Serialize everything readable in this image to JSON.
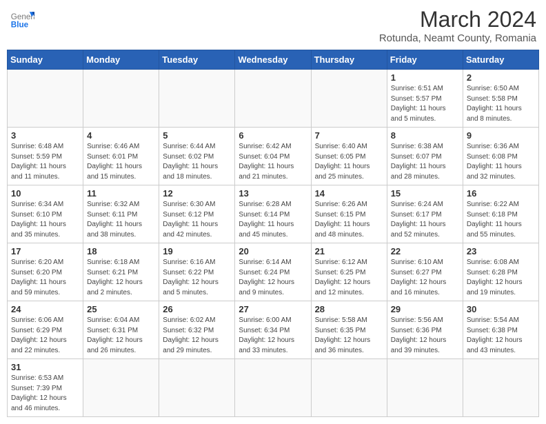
{
  "header": {
    "logo_general": "General",
    "logo_blue": "Blue",
    "month_title": "March 2024",
    "subtitle": "Rotunda, Neamt County, Romania"
  },
  "weekdays": [
    "Sunday",
    "Monday",
    "Tuesday",
    "Wednesday",
    "Thursday",
    "Friday",
    "Saturday"
  ],
  "weeks": [
    [
      {
        "day": "",
        "info": ""
      },
      {
        "day": "",
        "info": ""
      },
      {
        "day": "",
        "info": ""
      },
      {
        "day": "",
        "info": ""
      },
      {
        "day": "",
        "info": ""
      },
      {
        "day": "1",
        "info": "Sunrise: 6:51 AM\nSunset: 5:57 PM\nDaylight: 11 hours\nand 5 minutes."
      },
      {
        "day": "2",
        "info": "Sunrise: 6:50 AM\nSunset: 5:58 PM\nDaylight: 11 hours\nand 8 minutes."
      }
    ],
    [
      {
        "day": "3",
        "info": "Sunrise: 6:48 AM\nSunset: 5:59 PM\nDaylight: 11 hours\nand 11 minutes."
      },
      {
        "day": "4",
        "info": "Sunrise: 6:46 AM\nSunset: 6:01 PM\nDaylight: 11 hours\nand 15 minutes."
      },
      {
        "day": "5",
        "info": "Sunrise: 6:44 AM\nSunset: 6:02 PM\nDaylight: 11 hours\nand 18 minutes."
      },
      {
        "day": "6",
        "info": "Sunrise: 6:42 AM\nSunset: 6:04 PM\nDaylight: 11 hours\nand 21 minutes."
      },
      {
        "day": "7",
        "info": "Sunrise: 6:40 AM\nSunset: 6:05 PM\nDaylight: 11 hours\nand 25 minutes."
      },
      {
        "day": "8",
        "info": "Sunrise: 6:38 AM\nSunset: 6:07 PM\nDaylight: 11 hours\nand 28 minutes."
      },
      {
        "day": "9",
        "info": "Sunrise: 6:36 AM\nSunset: 6:08 PM\nDaylight: 11 hours\nand 32 minutes."
      }
    ],
    [
      {
        "day": "10",
        "info": "Sunrise: 6:34 AM\nSunset: 6:10 PM\nDaylight: 11 hours\nand 35 minutes."
      },
      {
        "day": "11",
        "info": "Sunrise: 6:32 AM\nSunset: 6:11 PM\nDaylight: 11 hours\nand 38 minutes."
      },
      {
        "day": "12",
        "info": "Sunrise: 6:30 AM\nSunset: 6:12 PM\nDaylight: 11 hours\nand 42 minutes."
      },
      {
        "day": "13",
        "info": "Sunrise: 6:28 AM\nSunset: 6:14 PM\nDaylight: 11 hours\nand 45 minutes."
      },
      {
        "day": "14",
        "info": "Sunrise: 6:26 AM\nSunset: 6:15 PM\nDaylight: 11 hours\nand 48 minutes."
      },
      {
        "day": "15",
        "info": "Sunrise: 6:24 AM\nSunset: 6:17 PM\nDaylight: 11 hours\nand 52 minutes."
      },
      {
        "day": "16",
        "info": "Sunrise: 6:22 AM\nSunset: 6:18 PM\nDaylight: 11 hours\nand 55 minutes."
      }
    ],
    [
      {
        "day": "17",
        "info": "Sunrise: 6:20 AM\nSunset: 6:20 PM\nDaylight: 11 hours\nand 59 minutes."
      },
      {
        "day": "18",
        "info": "Sunrise: 6:18 AM\nSunset: 6:21 PM\nDaylight: 12 hours\nand 2 minutes."
      },
      {
        "day": "19",
        "info": "Sunrise: 6:16 AM\nSunset: 6:22 PM\nDaylight: 12 hours\nand 5 minutes."
      },
      {
        "day": "20",
        "info": "Sunrise: 6:14 AM\nSunset: 6:24 PM\nDaylight: 12 hours\nand 9 minutes."
      },
      {
        "day": "21",
        "info": "Sunrise: 6:12 AM\nSunset: 6:25 PM\nDaylight: 12 hours\nand 12 minutes."
      },
      {
        "day": "22",
        "info": "Sunrise: 6:10 AM\nSunset: 6:27 PM\nDaylight: 12 hours\nand 16 minutes."
      },
      {
        "day": "23",
        "info": "Sunrise: 6:08 AM\nSunset: 6:28 PM\nDaylight: 12 hours\nand 19 minutes."
      }
    ],
    [
      {
        "day": "24",
        "info": "Sunrise: 6:06 AM\nSunset: 6:29 PM\nDaylight: 12 hours\nand 22 minutes."
      },
      {
        "day": "25",
        "info": "Sunrise: 6:04 AM\nSunset: 6:31 PM\nDaylight: 12 hours\nand 26 minutes."
      },
      {
        "day": "26",
        "info": "Sunrise: 6:02 AM\nSunset: 6:32 PM\nDaylight: 12 hours\nand 29 minutes."
      },
      {
        "day": "27",
        "info": "Sunrise: 6:00 AM\nSunset: 6:34 PM\nDaylight: 12 hours\nand 33 minutes."
      },
      {
        "day": "28",
        "info": "Sunrise: 5:58 AM\nSunset: 6:35 PM\nDaylight: 12 hours\nand 36 minutes."
      },
      {
        "day": "29",
        "info": "Sunrise: 5:56 AM\nSunset: 6:36 PM\nDaylight: 12 hours\nand 39 minutes."
      },
      {
        "day": "30",
        "info": "Sunrise: 5:54 AM\nSunset: 6:38 PM\nDaylight: 12 hours\nand 43 minutes."
      }
    ],
    [
      {
        "day": "31",
        "info": "Sunrise: 6:53 AM\nSunset: 7:39 PM\nDaylight: 12 hours\nand 46 minutes."
      },
      {
        "day": "",
        "info": ""
      },
      {
        "day": "",
        "info": ""
      },
      {
        "day": "",
        "info": ""
      },
      {
        "day": "",
        "info": ""
      },
      {
        "day": "",
        "info": ""
      },
      {
        "day": "",
        "info": ""
      }
    ]
  ]
}
